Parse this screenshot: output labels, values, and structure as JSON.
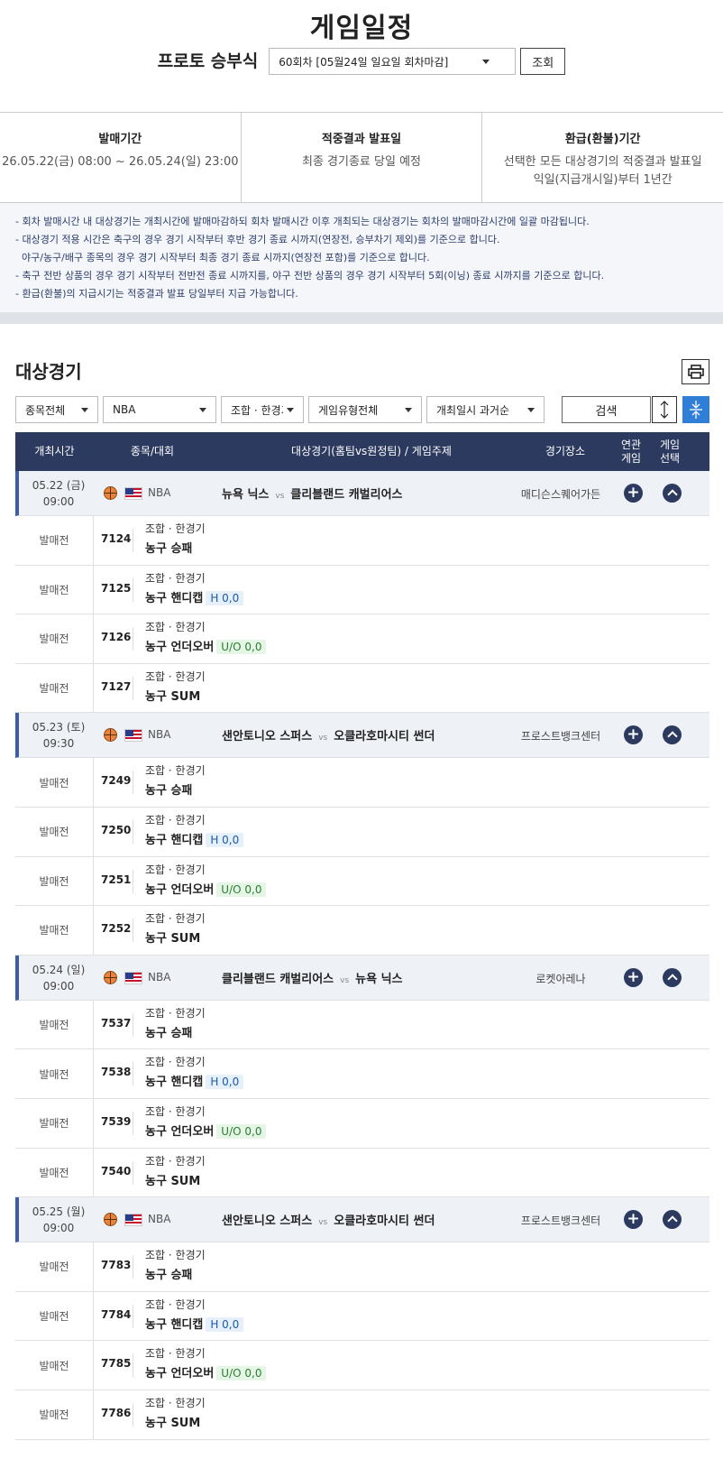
{
  "page": {
    "title": "게임일정",
    "round_label": "프로토 승부식",
    "round_select": "60회차 [05월24일 일요일 회차마감]",
    "lookup_button": "조회"
  },
  "info": [
    {
      "title": "발매기간",
      "lines": [
        "26.05.22(금) 08:00 ~ 26.05.24(일) 23:00"
      ]
    },
    {
      "title": "적중결과 발표일",
      "lines": [
        "최종 경기종료 당일 예정"
      ]
    },
    {
      "title": "환급(환불)기간",
      "lines": [
        "선택한 모든 대상경기의 적중결과 발표일",
        "익일(지급개시일)부터 1년간"
      ]
    }
  ],
  "notices": [
    "- 회차 발매시간 내 대상경기는 개최시간에 발매마감하되 회차 발매시간 이후 개최되는 대상경기는 회차의 발매마감시간에 일괄 마감됩니다.",
    "- 대상경기 적용 시간은 축구의 경우 경기 시작부터 후반 경기 종료 시까지(연장전, 승부차기 제외)를 기준으로 합니다.",
    "  야구/농구/배구 종목의 경우 경기 시작부터 최종 경기 종료 시까지(연장전 포함)를 기준으로 합니다.",
    "- 축구 전반 상품의 경우 경기 시작부터 전반전 종료 시까지를, 야구 전반 상품의 경우 경기 시작부터 5회(이닝) 종료 시까지를 기준으로 합니다.",
    "- 환급(환불)의 지급시기는 적중결과 발표 당일부터 지급 가능합니다."
  ],
  "section": {
    "title": "대상경기",
    "print_icon": "printer-icon"
  },
  "filters": {
    "sport": "종목전체",
    "league": "NBA",
    "combo": "조합 · 한경기",
    "game_type": "게임유형전체",
    "order": "개최일시 과거순",
    "search_button": "검색",
    "expand_icon": "expand-icon",
    "collapse_icon": "collapse-icon"
  },
  "table_headers": {
    "time": "개최시간",
    "sport": "종목/대회",
    "match": "대상경기(홈팀vs원정팀) / 게임주제",
    "venue": "경기장소",
    "related_1": "연관",
    "related_2": "게임",
    "select_1": "게임",
    "select_2": "선택"
  },
  "games": [
    {
      "date": "05.22 (금)",
      "time": "09:00",
      "league": "NBA",
      "home": "뉴욕 닉스",
      "vs": "vs",
      "away": "클리블랜드 캐벌리어스",
      "venue": "매디슨스퀘어가든",
      "bets": [
        {
          "status": "발매전",
          "num": "7124",
          "type": "조합 · 한경기",
          "name": "농구 승패",
          "badge": "",
          "badge_kind": ""
        },
        {
          "status": "발매전",
          "num": "7125",
          "type": "조합 · 한경기",
          "name": "농구 핸디캡",
          "badge": "H 0,0",
          "badge_kind": "h"
        },
        {
          "status": "발매전",
          "num": "7126",
          "type": "조합 · 한경기",
          "name": "농구 언더오버",
          "badge": "U/O 0,0",
          "badge_kind": "uo"
        },
        {
          "status": "발매전",
          "num": "7127",
          "type": "조합 · 한경기",
          "name": "농구 SUM",
          "badge": "",
          "badge_kind": ""
        }
      ]
    },
    {
      "date": "05.23 (토)",
      "time": "09:30",
      "league": "NBA",
      "home": "샌안토니오 스퍼스",
      "vs": "vs",
      "away": "오클라호마시티 썬더",
      "venue": "프로스트뱅크센터",
      "bets": [
        {
          "status": "발매전",
          "num": "7249",
          "type": "조합 · 한경기",
          "name": "농구 승패",
          "badge": "",
          "badge_kind": ""
        },
        {
          "status": "발매전",
          "num": "7250",
          "type": "조합 · 한경기",
          "name": "농구 핸디캡",
          "badge": "H 0,0",
          "badge_kind": "h"
        },
        {
          "status": "발매전",
          "num": "7251",
          "type": "조합 · 한경기",
          "name": "농구 언더오버",
          "badge": "U/O 0,0",
          "badge_kind": "uo"
        },
        {
          "status": "발매전",
          "num": "7252",
          "type": "조합 · 한경기",
          "name": "농구 SUM",
          "badge": "",
          "badge_kind": ""
        }
      ]
    },
    {
      "date": "05.24 (일)",
      "time": "09:00",
      "league": "NBA",
      "home": "클리블랜드 캐벌리어스",
      "vs": "vs",
      "away": "뉴욕 닉스",
      "venue": "로켓아레나",
      "bets": [
        {
          "status": "발매전",
          "num": "7537",
          "type": "조합 · 한경기",
          "name": "농구 승패",
          "badge": "",
          "badge_kind": ""
        },
        {
          "status": "발매전",
          "num": "7538",
          "type": "조합 · 한경기",
          "name": "농구 핸디캡",
          "badge": "H 0,0",
          "badge_kind": "h"
        },
        {
          "status": "발매전",
          "num": "7539",
          "type": "조합 · 한경기",
          "name": "농구 언더오버",
          "badge": "U/O 0,0",
          "badge_kind": "uo"
        },
        {
          "status": "발매전",
          "num": "7540",
          "type": "조합 · 한경기",
          "name": "농구 SUM",
          "badge": "",
          "badge_kind": ""
        }
      ]
    },
    {
      "date": "05.25 (월)",
      "time": "09:00",
      "league": "NBA",
      "home": "샌안토니오 스퍼스",
      "vs": "vs",
      "away": "오클라호마시티 썬더",
      "venue": "프로스트뱅크센터",
      "bets": [
        {
          "status": "발매전",
          "num": "7783",
          "type": "조합 · 한경기",
          "name": "농구 승패",
          "badge": "",
          "badge_kind": ""
        },
        {
          "status": "발매전",
          "num": "7784",
          "type": "조합 · 한경기",
          "name": "농구 핸디캡",
          "badge": "H 0,0",
          "badge_kind": "h"
        },
        {
          "status": "발매전",
          "num": "7785",
          "type": "조합 · 한경기",
          "name": "농구 언더오버",
          "badge": "U/O 0,0",
          "badge_kind": "uo"
        },
        {
          "status": "발매전",
          "num": "7786",
          "type": "조합 · 한경기",
          "name": "농구 SUM",
          "badge": "",
          "badge_kind": ""
        }
      ]
    }
  ]
}
